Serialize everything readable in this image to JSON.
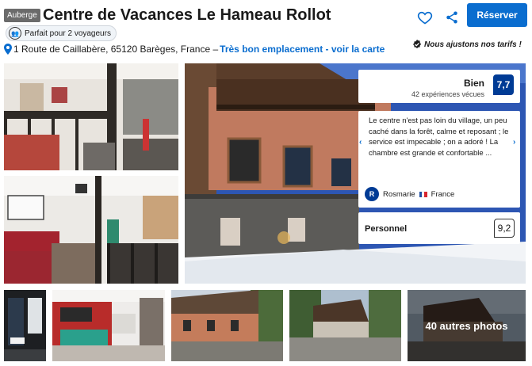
{
  "header": {
    "badge": "Auberge",
    "title": "Centre de Vacances Le Hameau Rollot",
    "reserve_label": "Réserver"
  },
  "suitability": {
    "label": "Parfait pour 2 voyageurs"
  },
  "address": {
    "text": "1 Route de Caillabère, 65120 Barèges, France –",
    "link": "Très bon emplacement - voir la carte"
  },
  "price_note": "Nous ajustons nos tarifs !",
  "review_summary": {
    "rating_label": "Bien",
    "count": "42 expériences vécues",
    "score": "7,7"
  },
  "featured_review": {
    "text": "Le centre n'est pas loin du village, un peu caché dans la forêt, calme et reposant ; le service est impecable ; on a adoré ! La chambre est grande et confortable ...",
    "reviewer_initial": "R",
    "reviewer_name": "Rosmarie",
    "reviewer_country": "France"
  },
  "staff": {
    "label": "Personnel",
    "score": "9,2"
  },
  "gallery": {
    "more_label": "40 autres photos"
  },
  "colors": {
    "brand_blue": "#0a6dcf",
    "score_blue": "#003b95"
  }
}
